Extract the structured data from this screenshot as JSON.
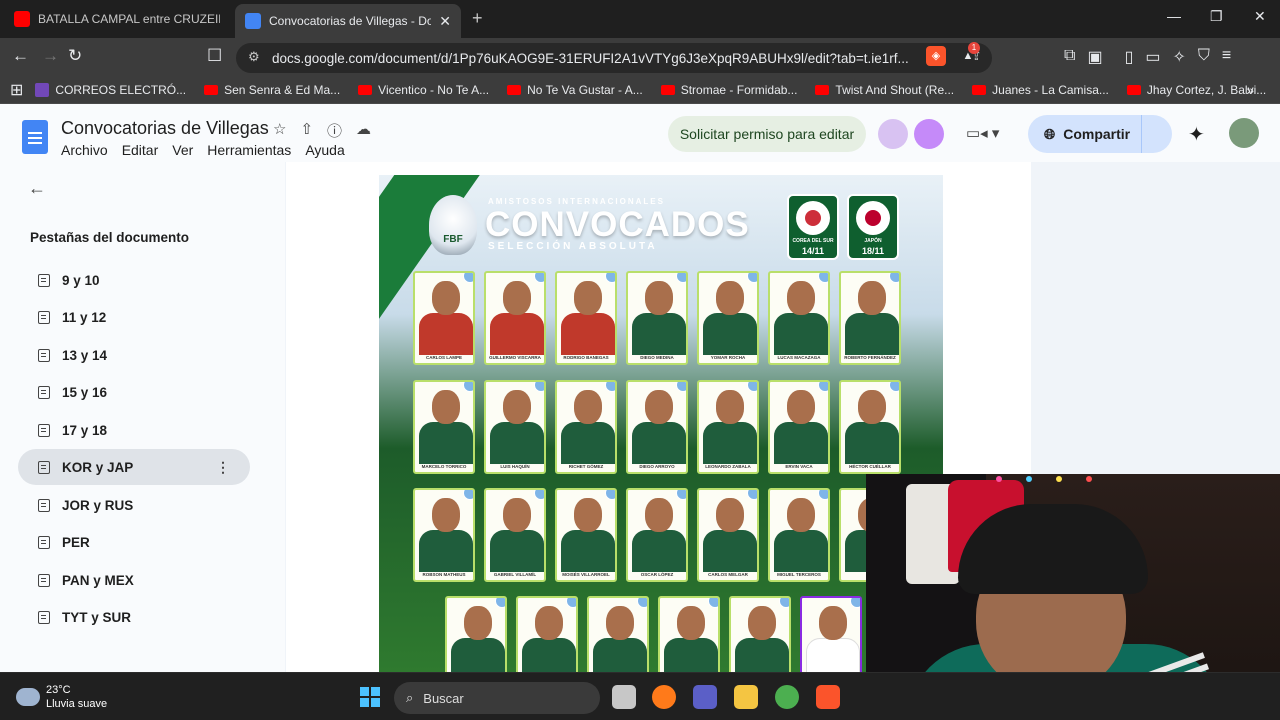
{
  "browser": {
    "tabs": [
      {
        "title": "BATALLA CAMPAL entre CRUZEIRO y",
        "favicon": "youtube",
        "active": false
      },
      {
        "title": "Convocatorias de Villegas - Docu",
        "favicon": "docs",
        "active": true
      }
    ],
    "url": "docs.google.com/document/d/1Pp76uKAOG9E-31ERUFI2A1vVTYg6J3eXpqR9ABUHx9l/edit?tab=t.ie1rf...",
    "extension_badge": "1",
    "bookmarks": [
      {
        "label": "CORREOS ELECTRÓ...",
        "icon": "purple-list"
      },
      {
        "label": "Sen Senra & Ed Ma...",
        "icon": "youtube"
      },
      {
        "label": "Vicentico - No Te A...",
        "icon": "youtube"
      },
      {
        "label": "No Te Va Gustar - A...",
        "icon": "youtube"
      },
      {
        "label": "Stromae - Formidab...",
        "icon": "youtube"
      },
      {
        "label": "Twist And Shout (Re...",
        "icon": "youtube"
      },
      {
        "label": "Juanes - La Camisa...",
        "icon": "youtube"
      },
      {
        "label": "Jhay Cortez, J. Balvi...",
        "icon": "youtube"
      }
    ]
  },
  "docs": {
    "title": "Convocatorias de Villegas",
    "menu": [
      "Archivo",
      "Editar",
      "Ver",
      "Herramientas",
      "Ayuda"
    ],
    "request_edit_label": "Solicitar permiso para editar",
    "share_label": "Compartir",
    "sidebar_title": "Pestañas del documento",
    "doc_tabs": [
      {
        "label": "9 y 10"
      },
      {
        "label": "11 y 12"
      },
      {
        "label": "13 y 14"
      },
      {
        "label": "15 y 16"
      },
      {
        "label": "17 y 18"
      },
      {
        "label": "KOR y JAP",
        "active": true
      },
      {
        "label": "JOR y RUS"
      },
      {
        "label": "PER"
      },
      {
        "label": "PAN y MEX"
      },
      {
        "label": "TYT y SUR"
      }
    ]
  },
  "poster": {
    "supertitle": "AMISTOSOS INTERNACIONALES",
    "heading": "CONVOCADOS",
    "subheading": "SELECCIÓN ABSOLUTA",
    "crest_text": "FBF",
    "matches": [
      {
        "country": "COREA DEL SUR",
        "date": "14/11",
        "flag_color": "#cd2e3a"
      },
      {
        "country": "JAPÓN",
        "date": "18/11",
        "flag_color": "#bc002d"
      }
    ],
    "players": [
      {
        "name": "CARLOS LAMPE",
        "kit": "red"
      },
      {
        "name": "GUILLERMO VISCARRA",
        "kit": "red"
      },
      {
        "name": "RODRIGO BANEGAS",
        "kit": "red"
      },
      {
        "name": "DIEGO MEDINA",
        "kit": "green"
      },
      {
        "name": "YOMAR ROCHA",
        "kit": "green"
      },
      {
        "name": "LUCAS MACAZAGA",
        "kit": "green"
      },
      {
        "name": "ROBERTO FERNÁNDEZ",
        "kit": "green"
      },
      {
        "name": "MARCELO TORRICO",
        "kit": "green"
      },
      {
        "name": "LUIS HAQUÍN",
        "kit": "green"
      },
      {
        "name": "RICHET GÓMEZ",
        "kit": "green"
      },
      {
        "name": "DIEGO ARROYO",
        "kit": "green"
      },
      {
        "name": "LEONARDO ZABALA",
        "kit": "green"
      },
      {
        "name": "ERVIN VACA",
        "kit": "green"
      },
      {
        "name": "HÉCTOR CUÉLLAR",
        "kit": "green"
      },
      {
        "name": "ROBSON MATHEUS",
        "kit": "green"
      },
      {
        "name": "GABRIEL VILLAMÍL",
        "kit": "green"
      },
      {
        "name": "MOISÉS VILLARROEL",
        "kit": "green"
      },
      {
        "name": "OSCAR LÓPEZ",
        "kit": "green"
      },
      {
        "name": "CARLOS MELGAR",
        "kit": "green"
      },
      {
        "name": "MIGUEL TERCEROS",
        "kit": "green"
      },
      {
        "name": "",
        "kit": "green"
      },
      {
        "name": "",
        "kit": "green"
      },
      {
        "name": "",
        "kit": "green"
      },
      {
        "name": "",
        "kit": "green"
      },
      {
        "name": "",
        "kit": "green"
      },
      {
        "name": "",
        "kit": "green"
      },
      {
        "name": "",
        "kit": "coach"
      }
    ]
  },
  "taskbar": {
    "temperature": "23°C",
    "weather": "Lluvia suave",
    "search_placeholder": "Buscar"
  }
}
